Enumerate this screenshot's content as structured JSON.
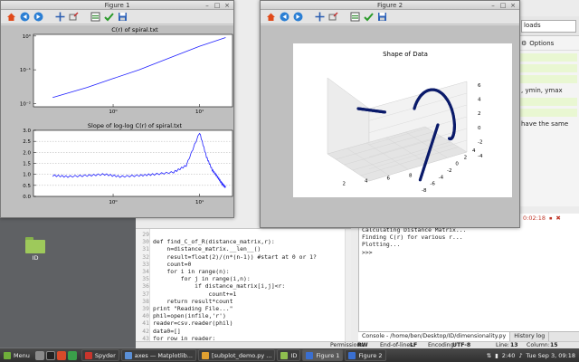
{
  "figure1": {
    "title": "Figure 1",
    "top_plot": {
      "title": "C(r) of spiral.txt",
      "y_ticks": [
        "10⁰",
        "10⁻¹",
        "10⁻²"
      ],
      "x_ticks": [
        "10⁰",
        "10¹"
      ]
    },
    "bottom_plot": {
      "title": "Slope of log-log C(r) of spiral.txt",
      "y_ticks": [
        "3.0",
        "2.5",
        "2.0",
        "1.5",
        "1.0",
        "0.5",
        "0.0"
      ],
      "x_ticks": [
        "10⁰",
        "10¹"
      ]
    }
  },
  "figure2": {
    "title": "Figure 2",
    "plot": {
      "title": "Shape of Data",
      "x_ticks": [
        "2",
        "4",
        "6",
        "8"
      ],
      "y_ticks": [
        "-8",
        "-6",
        "-4",
        "-2",
        "0",
        "2",
        "4"
      ],
      "z_ticks": [
        "6",
        "4",
        "2",
        "0",
        "-2",
        "-4"
      ]
    }
  },
  "chart_data": [
    {
      "type": "line",
      "title": "C(r) of spiral.txt",
      "xscale": "log",
      "yscale": "log",
      "x": [
        0.2,
        0.5,
        1,
        2,
        5,
        10,
        20
      ],
      "y": [
        0.015,
        0.03,
        0.055,
        0.1,
        0.25,
        0.5,
        0.9
      ],
      "color": "#1f1fff"
    },
    {
      "type": "line",
      "title": "Slope of log-log C(r) of spiral.txt",
      "xscale": "log",
      "ylim": [
        0,
        3.0
      ],
      "x": [
        0.2,
        0.3,
        0.5,
        0.8,
        1.2,
        2,
        3,
        5,
        7,
        10,
        12,
        14,
        16,
        18,
        20
      ],
      "y": [
        0.95,
        0.9,
        0.95,
        1.0,
        0.9,
        0.95,
        1.0,
        1.1,
        1.4,
        2.9,
        1.8,
        1.2,
        0.9,
        0.6,
        0.4
      ],
      "color": "#1f1fff"
    },
    {
      "type": "scatter",
      "title": "Shape of Data",
      "projection": "3d",
      "color": "#0a1a6a"
    }
  ],
  "background_app": {
    "right_panel": {
      "combo_value": "loads",
      "options_label": "Options",
      "snippet_1": ", ymin, ymax",
      "snippet_2": "have the same"
    },
    "editor": {
      "lines": [
        {
          "n": "29",
          "code": ""
        },
        {
          "n": "30",
          "code": "def find_C_of_R(distance_matrix,r):"
        },
        {
          "n": "31",
          "code": "    n=distance_matrix.__len__()"
        },
        {
          "n": "32",
          "code": "    result=float(2)/(n*(n-1)) #start at 0 or 1?"
        },
        {
          "n": "33",
          "code": "    count=0"
        },
        {
          "n": "34",
          "code": "    for i in range(n):"
        },
        {
          "n": "35",
          "code": "        for j in range(i,n):"
        },
        {
          "n": "36",
          "code": "            if distance_matrix[i,j]<r:"
        },
        {
          "n": "37",
          "code": "                count+=1"
        },
        {
          "n": "38",
          "code": "    return result*count"
        },
        {
          "n": "39",
          "code": "print \"Reading File...\""
        },
        {
          "n": "40",
          "code": "phil=open(infile,'r')"
        },
        {
          "n": "41",
          "code": "reader=csv.reader(phil)"
        },
        {
          "n": "42",
          "code": "data0=[]"
        },
        {
          "n": "43",
          "code": "for row in reader:"
        },
        {
          "n": "44",
          "code": "    data0.append([float(i) for i in row])"
        },
        {
          "n": "45",
          "code": ""
        }
      ]
    },
    "console": {
      "lines": [
        "Calculating Distance Matrix...",
        "Finding C(r) for various r...",
        "Plotting...",
        ">>>"
      ],
      "tabs": [
        "Console - /home/ben/Desktop/ID/dimensionality.py",
        "History log"
      ],
      "time": "0:02:18"
    },
    "status": {
      "permissions_label": "Permissions:",
      "permissions_value": "RW",
      "eol_label": "End-of-lines:",
      "eol_value": "LF",
      "encoding_label": "Encoding:",
      "encoding_value": "UTF-8",
      "line_label": "Line:",
      "line_value": "13",
      "column_label": "Column:",
      "column_value": "15"
    }
  },
  "desktop": {
    "folder_label": "ID"
  },
  "taskbar": {
    "menu_label": "Menu",
    "tasks": [
      {
        "label": "Spyder",
        "color": "#c8352c",
        "active": false
      },
      {
        "label": "axes — Matplotlib...",
        "color": "#5a8fd6",
        "active": false
      },
      {
        "label": "[subplot_demo.py ...",
        "color": "#e0a030",
        "active": false
      },
      {
        "label": "ID",
        "color": "#8fbf4f",
        "active": false
      },
      {
        "label": "Figure 1",
        "color": "#3a6fd0",
        "active": true
      },
      {
        "label": "Figure 2",
        "color": "#3a6fd0",
        "active": false
      }
    ],
    "battery": "2:40",
    "clock": "Tue Sep 3, 09:18"
  }
}
